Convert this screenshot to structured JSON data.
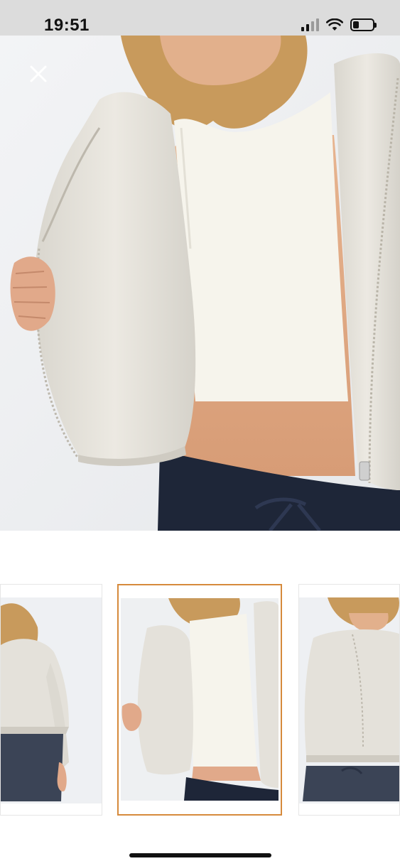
{
  "status_bar": {
    "time": "19:51",
    "signal_icon": "cellular-signal-icon",
    "wifi_icon": "wifi-icon",
    "battery_icon": "battery-icon",
    "battery_level": 0.3
  },
  "viewer": {
    "close_icon": "close-icon",
    "main_image": "jacket-front-open-photo"
  },
  "thumbnails": [
    {
      "image": "jacket-back-view-photo",
      "selected": false
    },
    {
      "image": "jacket-front-open-photo",
      "selected": true
    },
    {
      "image": "jacket-front-zipped-photo",
      "selected": false
    }
  ],
  "colors": {
    "selected_border": "#d68a3c",
    "jacket": "#e4e1da",
    "top": "#f4f2ea",
    "pants": "#1e2638"
  }
}
